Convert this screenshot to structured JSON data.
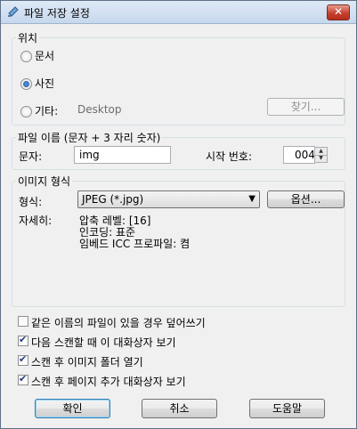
{
  "window": {
    "title": "파일 저장 설정"
  },
  "location": {
    "legend": "위치",
    "options": [
      {
        "label": "문서",
        "checked": false
      },
      {
        "label": "사진",
        "checked": true
      },
      {
        "label": "기타:",
        "checked": false
      }
    ],
    "other_path": "Desktop",
    "browse_button": "찾기..."
  },
  "filename": {
    "legend": "파일 이름 (문자 + 3 자리 숫자)",
    "prefix_label": "문자:",
    "prefix_value": "img",
    "start_label": "시작 번호:",
    "start_value": "004"
  },
  "image_format": {
    "legend": "이미지 형식",
    "type_label": "형식:",
    "type_value": "JPEG (*.jpg)",
    "options_button": "옵션...",
    "details_label": "자세히:",
    "details": [
      "압축 레벨: [16]",
      "인코딩: 표준",
      "임베드 ICC 프로파일: 켬"
    ]
  },
  "checkboxes": [
    {
      "label": "같은 이름의 파일이 있을 경우 덮어쓰기",
      "checked": false
    },
    {
      "label": "다음 스캔할 때 이 대화상자 보기",
      "checked": true
    },
    {
      "label": "스캔 후 이미지 폴더 열기",
      "checked": true
    },
    {
      "label": "스캔 후 페이지 추가 대화상자 보기",
      "checked": true
    }
  ],
  "buttons": {
    "ok": "확인",
    "cancel": "취소",
    "help": "도움말"
  }
}
